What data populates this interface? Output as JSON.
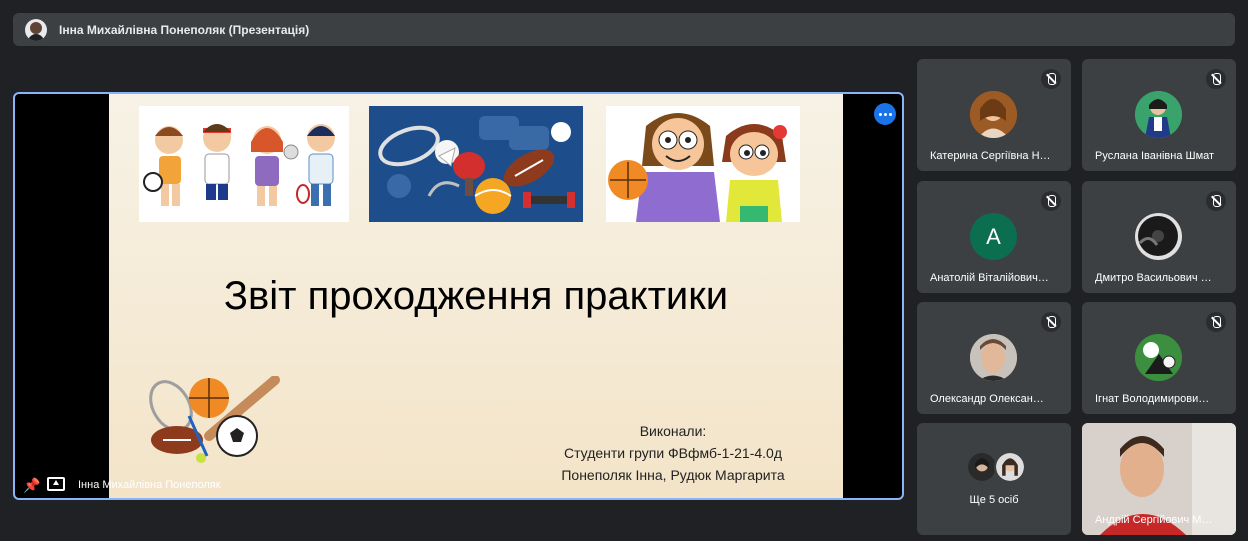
{
  "header": {
    "title": "Інна Михайлівна Понеполяк (Презентація)"
  },
  "presentation": {
    "slide_title": "Звіт проходження практики",
    "authors_heading": "Виконали:",
    "authors_line1": "Студенти групи ФВфмб-1-21-4.0д",
    "authors_line2": "Понеполяк Інна, Рудюк Маргарита",
    "presenter": "Інна Михайлівна Понеполяк"
  },
  "participants": [
    {
      "name": "Катерина Сергіївна Н…",
      "avatar_color": "#b5651d",
      "muted": true
    },
    {
      "name": "Руслана Іванівна Шмат",
      "avatar_color": "#2e8b57",
      "muted": true
    },
    {
      "name": "Анатолій Віталійович…",
      "initial": "A",
      "avatar_color": "#0b6e4f",
      "muted": true
    },
    {
      "name": "Дмитро Васильович …",
      "avatar_color": "#2b2b2b",
      "muted": true
    },
    {
      "name": "Олександр Олексан…",
      "avatar_color": "#c9a38a",
      "muted": true
    },
    {
      "name": "Ігнат Володимирови…",
      "avatar_color": "#2e7d32",
      "muted": true
    },
    {
      "name": "Андрій Сергійович М…",
      "video": true
    }
  ],
  "others": {
    "label": "Ще 5 осіб"
  },
  "colors": {
    "accent": "#8ab4f8",
    "surface": "#3c4043",
    "background": "#202124"
  }
}
